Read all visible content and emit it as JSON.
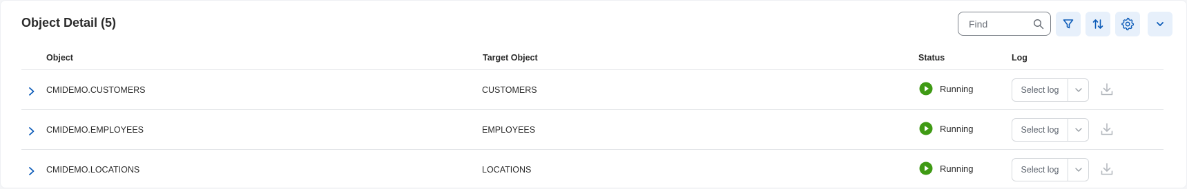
{
  "panel": {
    "title": "Object Detail (5)",
    "find": {
      "placeholder": "Find"
    }
  },
  "toolbar": {
    "filter_icon": "filter-icon",
    "sort_icon": "sort-icon",
    "settings_icon": "gear-icon",
    "collapse_icon": "chevron-down-icon"
  },
  "columns": {
    "object": "Object",
    "target": "Target Object",
    "status": "Status",
    "log": "Log"
  },
  "rows": [
    {
      "object": "CMIDEMO.CUSTOMERS",
      "target": "CUSTOMERS",
      "status": "Running",
      "log_placeholder": "Select log"
    },
    {
      "object": "CMIDEMO.EMPLOYEES",
      "target": "EMPLOYEES",
      "status": "Running",
      "log_placeholder": "Select log"
    },
    {
      "object": "CMIDEMO.LOCATIONS",
      "target": "LOCATIONS",
      "status": "Running",
      "log_placeholder": "Select log"
    }
  ],
  "colors": {
    "accent": "#0c5bb8",
    "button_bg": "#e7f0fb",
    "running": "#3f9a14",
    "disabled": "#b5b9bf"
  }
}
